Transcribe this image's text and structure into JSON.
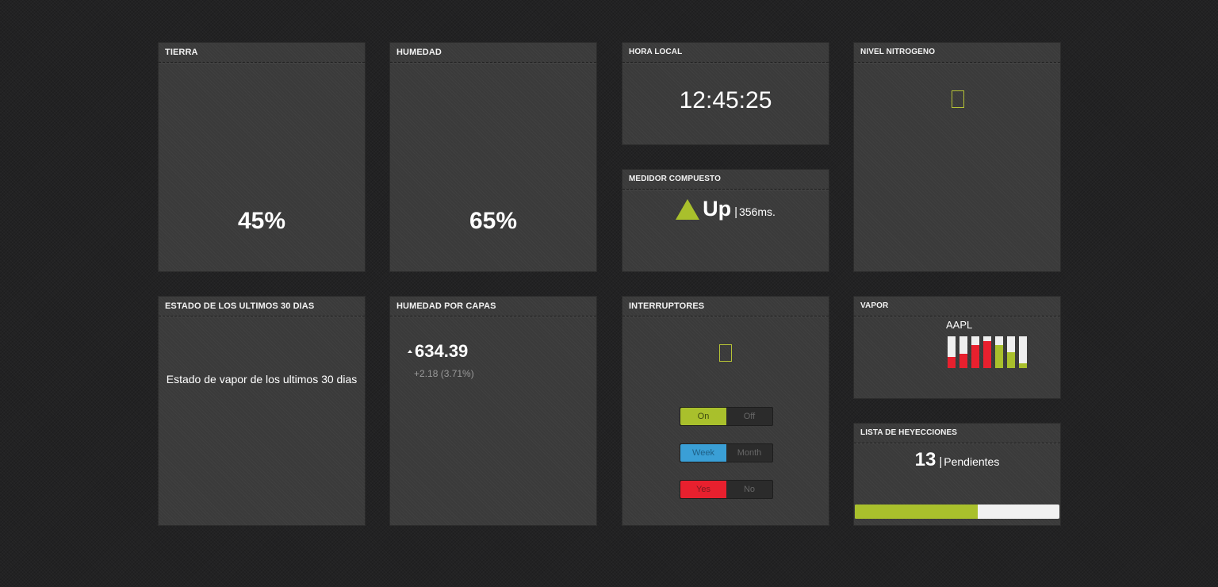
{
  "colors": {
    "green": "#a9c02c",
    "blue": "#3a9fd6",
    "red": "#e8202e",
    "bar_track": "#efefef"
  },
  "tierra": {
    "title": "TIERRA",
    "value": "45%"
  },
  "humedad": {
    "title": "HUMEDAD",
    "value": "65%"
  },
  "hora_local": {
    "title": "HORA LOCAL",
    "time": "12:45:25"
  },
  "nivel_nitrogeno": {
    "title": "NIVEL NITROGENO",
    "icon": "placeholder-icon"
  },
  "medidor_compuesto": {
    "title": "MEDIDOR COMPUESTO",
    "icon": "triangle-up-icon",
    "status": "Up",
    "separator": "|",
    "latency": "356ms."
  },
  "estado": {
    "title": "ESTADO DE LOS ULTIMOS 30 DIAS",
    "text": "Estado de vapor de los ultimos 30 dias"
  },
  "humedad_capas": {
    "title": "HUMEDAD POR CAPAS",
    "value": "634.39",
    "change": "+2.18 (3.71%)",
    "icon": "arrow-up-icon"
  },
  "interruptores": {
    "title": "INTERRUPTORES",
    "icon": "placeholder-icon",
    "toggles": [
      {
        "on": "On",
        "off": "Off",
        "color": "#a9c02c"
      },
      {
        "on": "Week",
        "off": "Month",
        "color": "#3a9fd6"
      },
      {
        "on": "Yes",
        "off": "No",
        "color": "#e8202e"
      }
    ]
  },
  "vapor": {
    "title": "VAPOR",
    "symbol": "AAPL",
    "bars": [
      {
        "value": 0.35,
        "color": "#e8202e"
      },
      {
        "value": 0.45,
        "color": "#e8202e"
      },
      {
        "value": 0.72,
        "color": "#e8202e"
      },
      {
        "value": 0.85,
        "color": "#e8202e"
      },
      {
        "value": 0.72,
        "color": "#a9c02c"
      },
      {
        "value": 0.5,
        "color": "#a9c02c"
      },
      {
        "value": 0.15,
        "color": "#a9c02c"
      }
    ]
  },
  "lista": {
    "title": "LISTA DE HEYECCIONES",
    "count": "13",
    "separator": "|",
    "label": "Pendientes",
    "progress": 0.6
  }
}
